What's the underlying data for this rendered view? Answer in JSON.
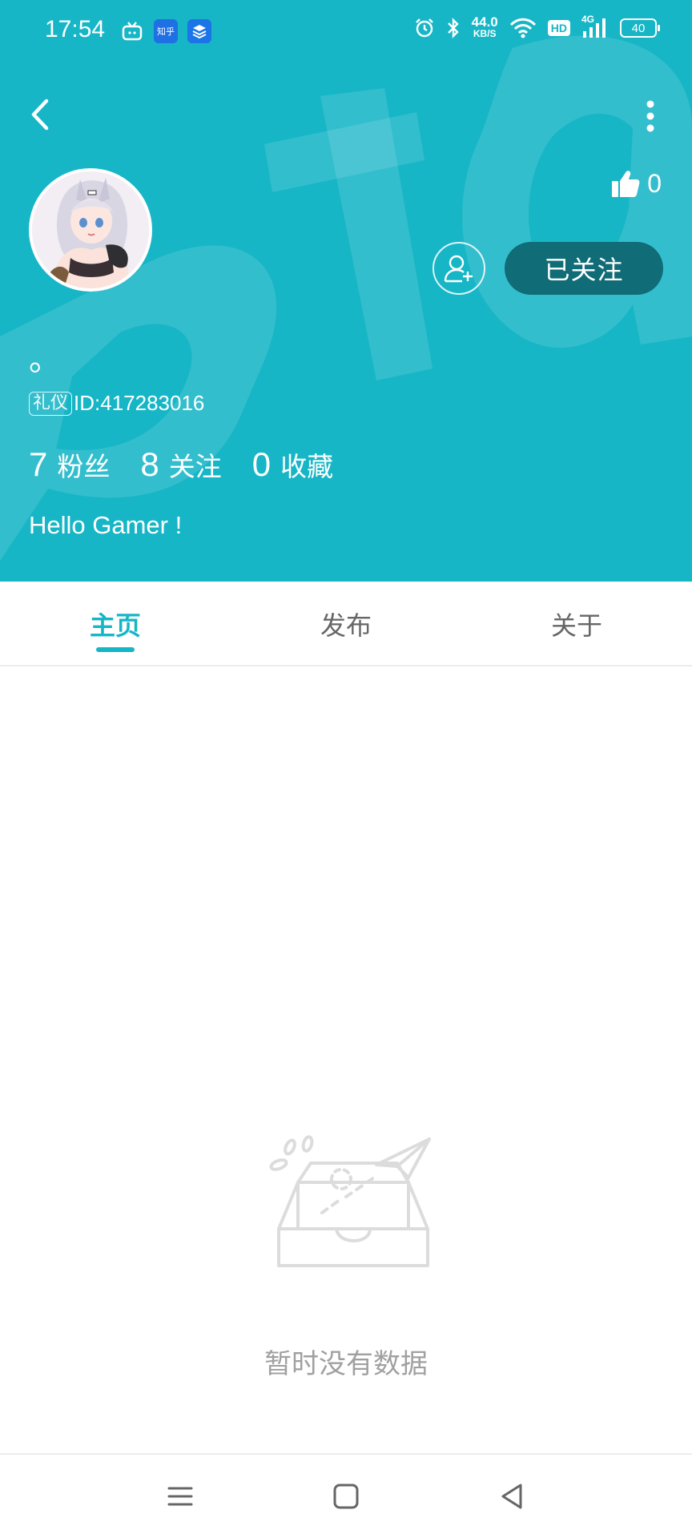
{
  "status_bar": {
    "time": "17:54",
    "apps": [
      {
        "icon": "tv-app-icon",
        "label": ""
      },
      {
        "icon": "zhihu-app-icon",
        "label": "知乎"
      },
      {
        "icon": "layers-app-icon",
        "label": ""
      }
    ],
    "net_speed_value": "44.0",
    "net_speed_unit": "KB/S",
    "hd_label": "HD",
    "signal_label": "4G",
    "battery": "40"
  },
  "profile": {
    "nickname": "。",
    "badge": "礼仪",
    "id_text": "ID:417283016",
    "likes": "0",
    "follow_button": "已关注",
    "bio": "Hello Gamer !",
    "stats": [
      {
        "count": "7",
        "label": "粉丝"
      },
      {
        "count": "8",
        "label": "关注"
      },
      {
        "count": "0",
        "label": "收藏"
      }
    ]
  },
  "tabs": [
    {
      "label": "主页",
      "active": true
    },
    {
      "label": "发布",
      "active": false
    },
    {
      "label": "关于",
      "active": false
    }
  ],
  "empty_state": {
    "text": "暂时没有数据"
  },
  "colors": {
    "header_bg": "#17b6c6",
    "follow_button_bg": "#106c76",
    "accent": "#17b6c6",
    "empty_text": "#a0a0a0"
  }
}
